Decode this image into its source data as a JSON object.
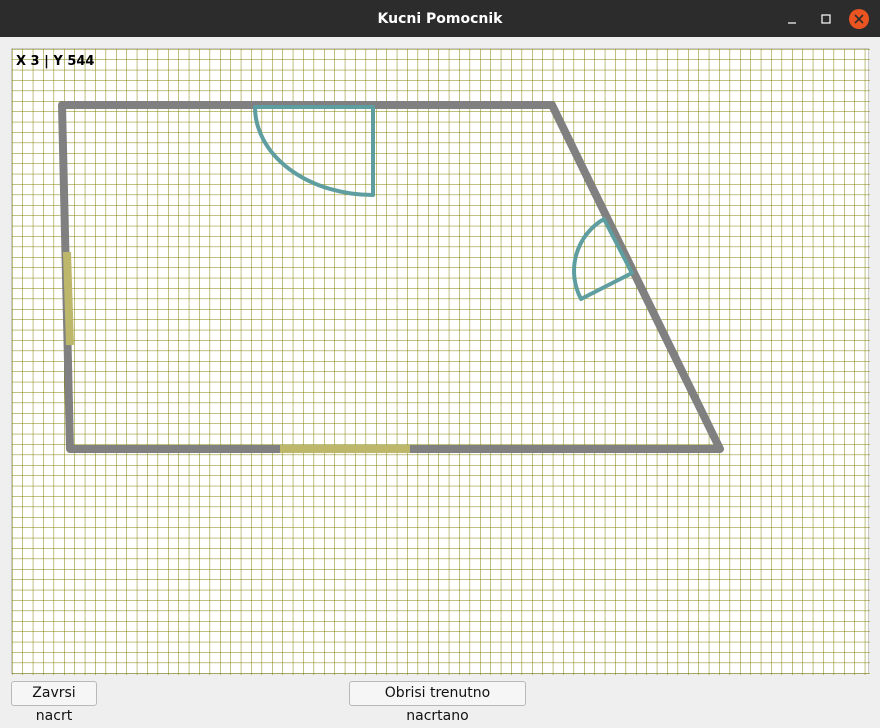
{
  "window": {
    "title": "Kucni Pomocnik",
    "controls": {
      "minimize": "minimize-icon",
      "maximize": "maximize-icon",
      "close": "close-icon"
    },
    "close_color": "#e95420"
  },
  "canvas": {
    "coords_text": "X 3 | Y 544",
    "grid_color": "#7f7f00",
    "wall_color": "#808080",
    "door_color": "#5f9ea0",
    "window_color": "#bdb76b"
  },
  "buttons": {
    "finish": "Zavrsi nacrt",
    "clear": "Obrisi trenutno nacrtano"
  }
}
